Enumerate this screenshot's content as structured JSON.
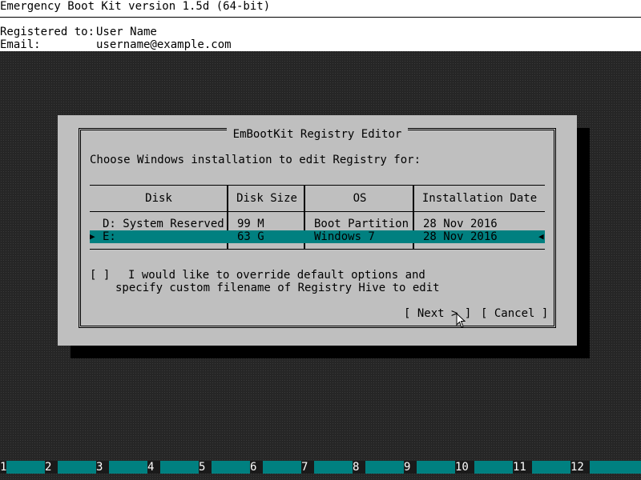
{
  "header": {
    "title": "Emergency Boot Kit version 1.5d (64-bit)",
    "registered_label": "Registered to:",
    "registered_value": "User Name",
    "email_label": "Email:",
    "email_value": "username@example.com"
  },
  "dialog": {
    "title": "EmBootKit Registry Editor",
    "prompt": "Choose Windows installation to edit Registry for:",
    "table": {
      "columns": [
        "Disk",
        "Disk Size",
        "OS",
        "Installation Date"
      ],
      "rows": [
        {
          "disk": "D: System Reserved",
          "size": "99 M",
          "os": "Boot Partition",
          "date": "28 Nov 2016",
          "selected": false
        },
        {
          "disk": "E:",
          "size": "63 G",
          "os": "Windows 7",
          "date": "28 Nov 2016",
          "selected": true
        }
      ]
    },
    "checkbox": {
      "mark": "[ ]",
      "line1": "I would like to override default options and",
      "line2": "specify custom filename of Registry Hive to edit"
    },
    "buttons": {
      "next": "[ Next > ]",
      "cancel": "[ Cancel ]"
    }
  },
  "fkeys": [
    "1",
    "2",
    "3",
    "4",
    "5",
    "6",
    "7",
    "8",
    "9",
    "10",
    "11",
    "12"
  ],
  "colors": {
    "background": "#262626",
    "dialog": "#bfbfbf",
    "selection": "#008080",
    "header": "#ffffff"
  }
}
